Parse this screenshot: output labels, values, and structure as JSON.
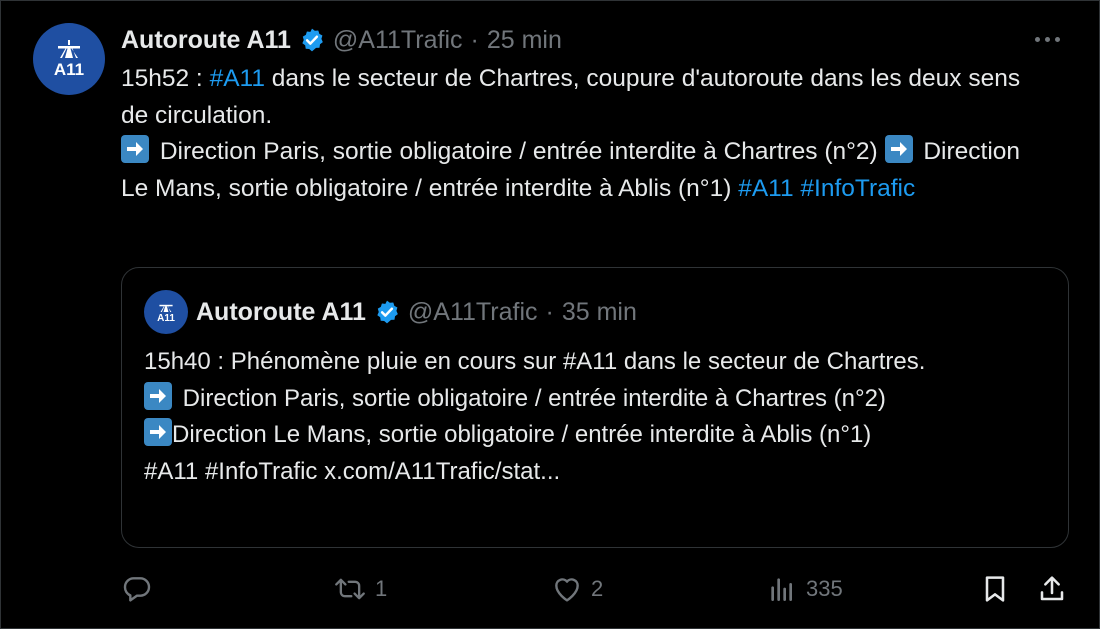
{
  "tweet": {
    "avatar_label": "A11",
    "author_name": "Autoroute A11",
    "handle": "@A11Trafic",
    "separator": "·",
    "time": "25 min",
    "line1_time": "15h52 :",
    "line1_hashtag": "#A11",
    "line1_rest": "dans le secteur de Chartres, coupure d'autoroute dans les deux sens de circulation.",
    "dir1": "Direction Paris, sortie obligatoire / entrée interdite à Chartres (n°2)",
    "dir2": "Direction Le Mans, sortie obligatoire / entrée interdite à Ablis (n°1)",
    "hashtag_end1": "#A11",
    "hashtag_end2": "#InfoTrafic"
  },
  "quoted": {
    "avatar_label": "A11",
    "author_name": "Autoroute A11",
    "handle": "@A11Trafic",
    "separator": "·",
    "time": "35 min",
    "line1": "15h40 : Phénomène pluie en cours sur #A11 dans le secteur de Chartres.",
    "dir1": "Direction Paris, sortie obligatoire / entrée interdite à Chartres (n°2)",
    "dir2": "Direction Le Mans, sortie obligatoire / entrée interdite à Ablis (n°1)",
    "last_line": "#A11  #InfoTrafic x.com/A11Trafic/stat..."
  },
  "actions": {
    "replies": "",
    "reposts": "1",
    "likes": "2",
    "views": "335"
  },
  "colors": {
    "background": "#000000",
    "text": "#e7e9ea",
    "muted": "#71767b",
    "link": "#1d9bf0",
    "border": "#2f3336",
    "avatar": "#1f4fa2"
  }
}
